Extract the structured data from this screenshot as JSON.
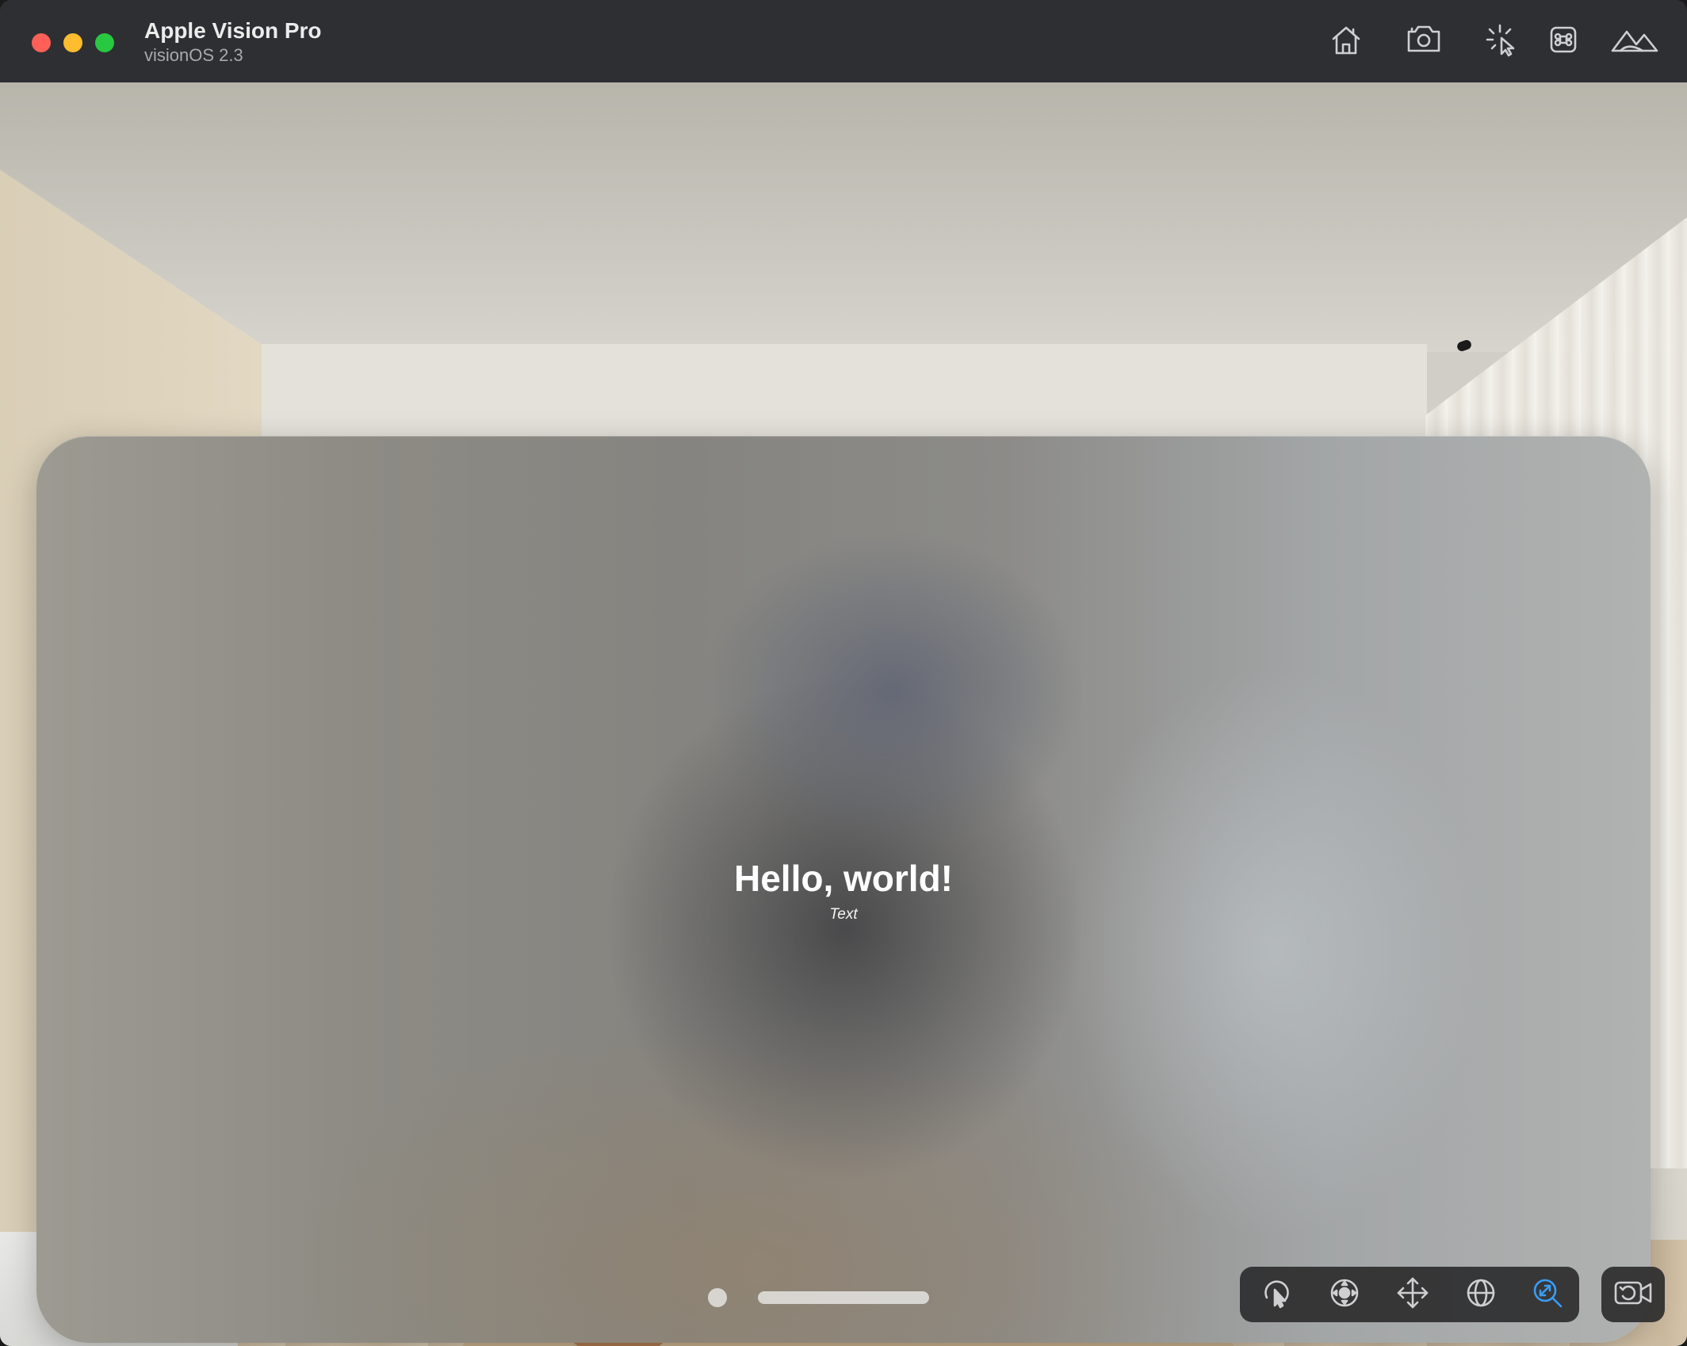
{
  "window": {
    "title": "Apple Vision Pro",
    "subtitle": "visionOS 2.3"
  },
  "toolbar": {
    "icons": [
      "home-icon",
      "screenshot-camera-icon",
      "tap-pointer-icon",
      "command-key-icon",
      "environment-mountains-icon"
    ]
  },
  "app": {
    "headline": "Hello, world!",
    "caption": "Text"
  },
  "controls": {
    "items": [
      "interact-icon",
      "look-around-icon",
      "pan-move-icon",
      "orbit-icon",
      "zoom-icon"
    ],
    "active": "zoom-icon",
    "accent_color": "#3a9cf5"
  },
  "camera_button": {
    "icon": "reset-camera-icon"
  },
  "colors": {
    "close": "#fe5f57",
    "minimize": "#febc2e",
    "maximize": "#28c840",
    "titlebar": "#2e2f32"
  }
}
